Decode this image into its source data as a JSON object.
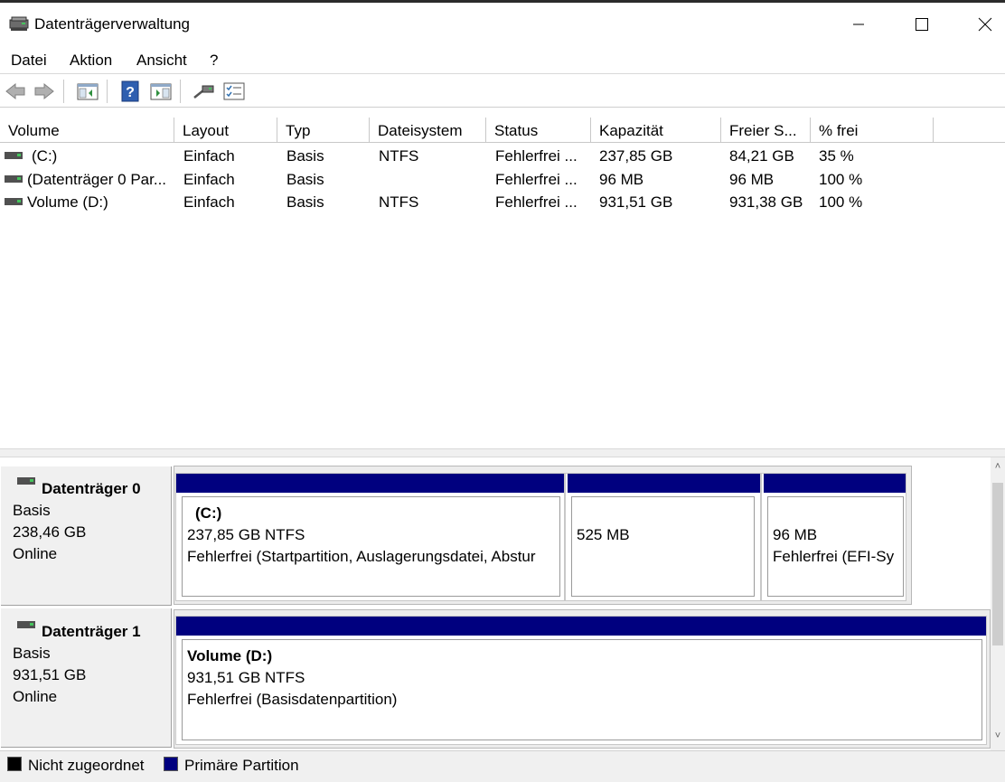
{
  "window": {
    "title": "Datenträgerverwaltung"
  },
  "menu": {
    "items": [
      "Datei",
      "Aktion",
      "Ansicht",
      "?"
    ]
  },
  "toolbar": {
    "icons": [
      "back-arrow-icon",
      "forward-arrow-icon",
      "console-tree-icon",
      "help-icon",
      "action-pane-icon",
      "connect-icon",
      "properties-list-icon"
    ]
  },
  "volume_list": {
    "columns": [
      "Volume",
      "Layout",
      "Typ",
      "Dateisystem",
      "Status",
      "Kapazität",
      "Freier S...",
      "% frei"
    ],
    "rows": [
      {
        "volume": "(C:)",
        "layout": "Einfach",
        "typ": "Basis",
        "fs": "NTFS",
        "status": "Fehlerfrei ...",
        "capacity": "237,85 GB",
        "free": "84,21 GB",
        "pct": "35 %"
      },
      {
        "volume": "(Datenträger 0 Par...",
        "layout": "Einfach",
        "typ": "Basis",
        "fs": "",
        "status": "Fehlerfrei ...",
        "capacity": "96 MB",
        "free": "96 MB",
        "pct": "100 %"
      },
      {
        "volume": "Volume (D:)",
        "layout": "Einfach",
        "typ": "Basis",
        "fs": "NTFS",
        "status": "Fehlerfrei ...",
        "capacity": "931,51 GB",
        "free": "931,38 GB",
        "pct": "100 %"
      }
    ]
  },
  "disks": [
    {
      "name": "Datenträger 0",
      "type": "Basis",
      "size": "238,46 GB",
      "state": "Online",
      "partitions": [
        {
          "title": "(C:)",
          "size": "237,85 GB NTFS",
          "status": "Fehlerfrei (Startpartition, Auslagerungsdatei, Abstur"
        },
        {
          "title": "",
          "size": "525 MB",
          "status": ""
        },
        {
          "title": "",
          "size": "96 MB",
          "status": "Fehlerfrei (EFI-Sy"
        }
      ]
    },
    {
      "name": "Datenträger 1",
      "type": "Basis",
      "size": "931,51 GB",
      "state": "Online",
      "partitions": [
        {
          "title": "Volume  (D:)",
          "size": "931,51 GB NTFS",
          "status": "Fehlerfrei (Basisdatenpartition)"
        }
      ]
    }
  ],
  "legend": [
    {
      "label": "Nicht zugeordnet",
      "color": "#000000"
    },
    {
      "label": "Primäre Partition",
      "color": "#00007f"
    }
  ],
  "colors": {
    "primary_partition": "#00007f",
    "unallocated": "#000000"
  }
}
